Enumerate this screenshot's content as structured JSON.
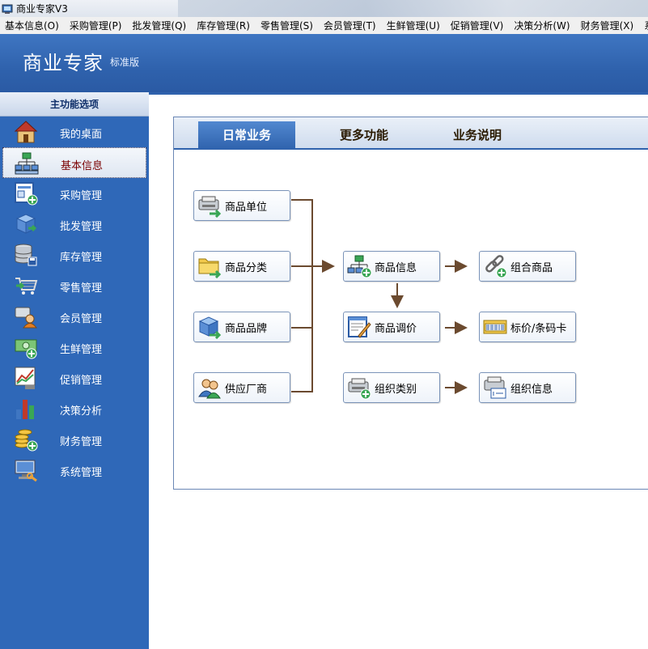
{
  "window": {
    "title": "商业专家V3"
  },
  "menu": [
    "基本信息(O)",
    "采购管理(P)",
    "批发管理(Q)",
    "库存管理(R)",
    "零售管理(S)",
    "会员管理(T)",
    "生鲜管理(U)",
    "促销管理(V)",
    "决策分析(W)",
    "财务管理(X)",
    "系"
  ],
  "header": {
    "brand": "商业专家",
    "edition": "标准版"
  },
  "sidebar": {
    "title": "主功能选项",
    "items": [
      {
        "label": "我的桌面",
        "icon": "house-icon"
      },
      {
        "label": "基本信息",
        "icon": "org-tree-icon",
        "active": true
      },
      {
        "label": "采购管理",
        "icon": "purchase-form-icon"
      },
      {
        "label": "批发管理",
        "icon": "wholesale-box-icon"
      },
      {
        "label": "库存管理",
        "icon": "database-icon"
      },
      {
        "label": "零售管理",
        "icon": "shopping-cart-icon"
      },
      {
        "label": "会员管理",
        "icon": "member-card-icon"
      },
      {
        "label": "生鲜管理",
        "icon": "cash-icon"
      },
      {
        "label": "促销管理",
        "icon": "promotion-chart-icon"
      },
      {
        "label": "决策分析",
        "icon": "bar-chart-icon"
      },
      {
        "label": "财务管理",
        "icon": "coins-icon"
      },
      {
        "label": "系统管理",
        "icon": "computer-settings-icon"
      }
    ]
  },
  "tabs": [
    {
      "label": "日常业务",
      "active": true
    },
    {
      "label": "更多功能"
    },
    {
      "label": "业务说明"
    }
  ],
  "nodes": {
    "unit": "商品单位",
    "category": "商品分类",
    "brand": "商品品牌",
    "supplier": "供应厂商",
    "product_info": "商品信息",
    "price_adjust": "商品调价",
    "org_category": "组织类别",
    "combo": "组合商品",
    "label_card": "标价/条码卡",
    "org_info": "组织信息"
  },
  "colors": {
    "accent": "#2f62ad",
    "sidebar": "#2f68b8",
    "arrow": "#6b4a2f"
  }
}
